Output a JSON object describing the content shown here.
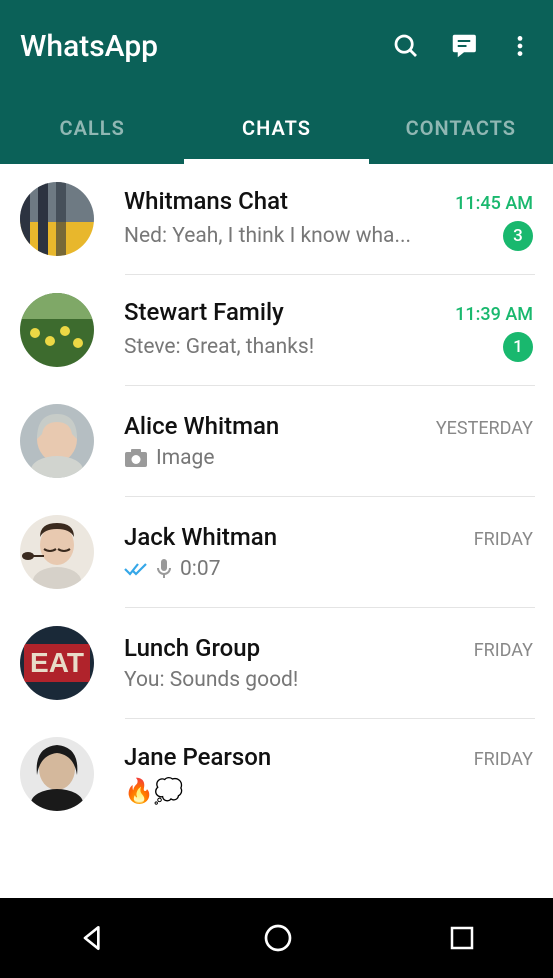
{
  "app_title": "WhatsApp",
  "tabs": {
    "calls": "CALLS",
    "chats": "CHATS",
    "contacts": "CONTACTS"
  },
  "active_tab": "chats",
  "colors": {
    "header": "#0b6158",
    "accent": "#19b86e"
  },
  "chats": [
    {
      "name": "Whitmans Chat",
      "message": "Ned: Yeah, I think I know wha...",
      "time": "11:45 AM",
      "unread": "3"
    },
    {
      "name": "Stewart Family",
      "message": "Steve: Great, thanks!",
      "time": "11:39 AM",
      "unread": "1"
    },
    {
      "name": "Alice Whitman",
      "message": "Image",
      "time": "YESTERDAY",
      "icon": "camera"
    },
    {
      "name": "Jack Whitman",
      "message": "0:07",
      "time": "FRIDAY",
      "icon": "voice"
    },
    {
      "name": "Lunch Group",
      "message": "You: Sounds good!",
      "time": "FRIDAY"
    },
    {
      "name": "Jane Pearson",
      "message": "🔥💭",
      "time": "FRIDAY"
    }
  ]
}
